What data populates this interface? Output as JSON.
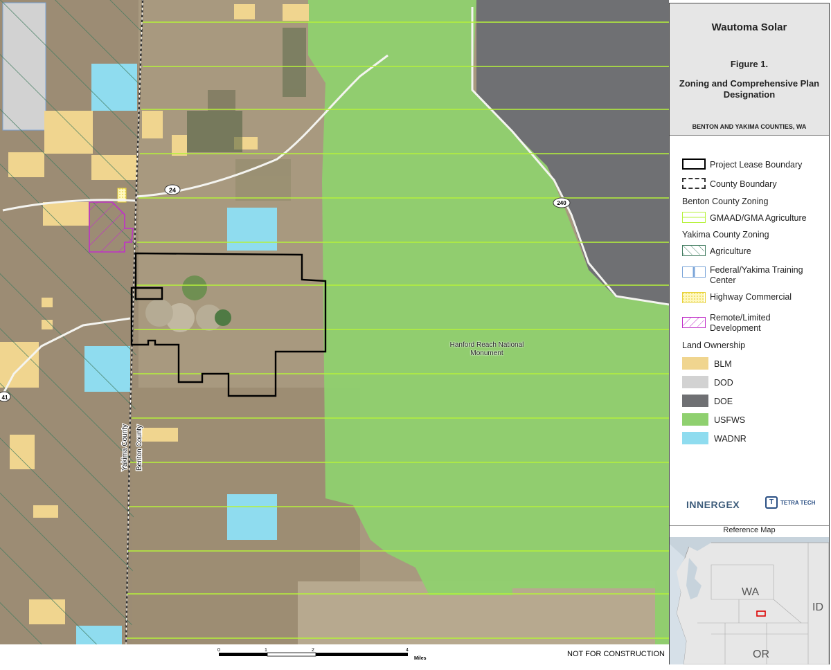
{
  "panel": {
    "title": "Wautoma Solar",
    "figure": "Figure 1.",
    "subtitle": "Zoning and Comprehensive Plan Designation",
    "location": "BENTON AND YAKIMA COUNTIES, WA"
  },
  "legend": {
    "project_lease": "Project Lease Boundary",
    "county_boundary": "County Boundary",
    "benton_heading": "Benton County Zoning",
    "gmaad": "GMAAD/GMA Agriculture",
    "yakima_heading": "Yakima County Zoning",
    "agriculture": "Agriculture",
    "federal_training": "Federal/Yakima Training Center",
    "highway_commercial": "Highway Commercial",
    "remote_limited": "Remote/Limited Development",
    "ownership_heading": "Land Ownership",
    "blm": "BLM",
    "dod": "DOD",
    "doe": "DOE",
    "usfws": "USFWS",
    "wadnr": "WADNR"
  },
  "colors": {
    "blm": "#f0d58f",
    "dod": "#d2d2d2",
    "doe": "#6f7073",
    "usfws": "#8fd06f",
    "wadnr": "#8fdcef",
    "gma": "#b6f23a",
    "agri_hatch": "#3f7a5e",
    "remote": "#c030c8",
    "terrain": "#a8997f"
  },
  "logos": {
    "innergex": "INNERGEX",
    "tetratech": "TETRA TECH"
  },
  "reference_map": {
    "title": "Reference Map",
    "wa": "WA",
    "id": "ID",
    "or": "OR"
  },
  "map": {
    "monument": "Hanford Reach National Monument",
    "highway_24": "24",
    "highway_240": "240",
    "highway_241": "41",
    "yakima_county": "Yakima County",
    "benton_county": "Benton County"
  },
  "scalebar": {
    "ticks": [
      "0",
      "1",
      "2",
      "4"
    ],
    "unit": "Miles",
    "note": "NOT FOR CONSTRUCTION"
  }
}
